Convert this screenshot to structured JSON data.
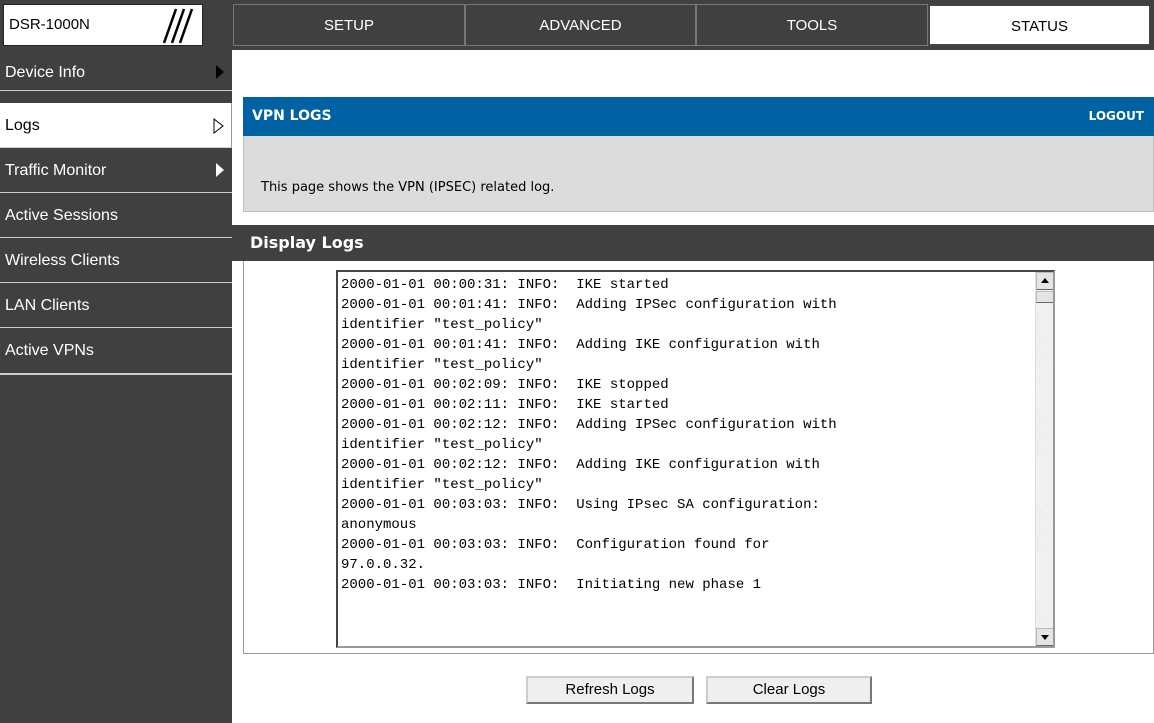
{
  "brand": {
    "model": "DSR-1000N"
  },
  "nav": {
    "tabs": [
      {
        "label": "SETUP"
      },
      {
        "label": "ADVANCED"
      },
      {
        "label": "TOOLS"
      },
      {
        "label": "STATUS",
        "active": true
      }
    ]
  },
  "sidebar": {
    "items": [
      {
        "label": "Device Info",
        "has_submenu": true
      },
      {
        "label": "Logs",
        "active": true,
        "has_submenu": true
      },
      {
        "label": "Traffic Monitor",
        "has_submenu": true
      },
      {
        "label": "Active Sessions"
      },
      {
        "label": "Wireless Clients"
      },
      {
        "label": "LAN Clients"
      },
      {
        "label": "Active VPNs"
      }
    ]
  },
  "header": {
    "title": "VPN LOGS",
    "logout_label": "LOGOUT"
  },
  "description": "This page shows the VPN (IPSEC) related log.",
  "logs": {
    "title": "Display Logs",
    "lines": [
      "2000-01-01 00:00:31: INFO:  IKE started",
      "2000-01-01 00:01:41: INFO:  Adding IPSec configuration with",
      "identifier \"test_policy\"",
      "2000-01-01 00:01:41: INFO:  Adding IKE configuration with",
      "identifier \"test_policy\"",
      "2000-01-01 00:02:09: INFO:  IKE stopped",
      "2000-01-01 00:02:11: INFO:  IKE started",
      "2000-01-01 00:02:12: INFO:  Adding IPSec configuration with",
      "identifier \"test_policy\"",
      "2000-01-01 00:02:12: INFO:  Adding IKE configuration with",
      "identifier \"test_policy\"",
      "2000-01-01 00:03:03: INFO:  Using IPsec SA configuration:",
      "anonymous",
      "2000-01-01 00:03:03: INFO:  Configuration found for",
      "97.0.0.32.",
      "2000-01-01 00:03:03: INFO:  Initiating new phase 1"
    ]
  },
  "buttons": {
    "refresh": "Refresh Logs",
    "clear": "Clear Logs"
  },
  "colors": {
    "header_blue": "#0061a3",
    "dark_gray": "#404040",
    "desc_gray": "#dcdcdc"
  }
}
